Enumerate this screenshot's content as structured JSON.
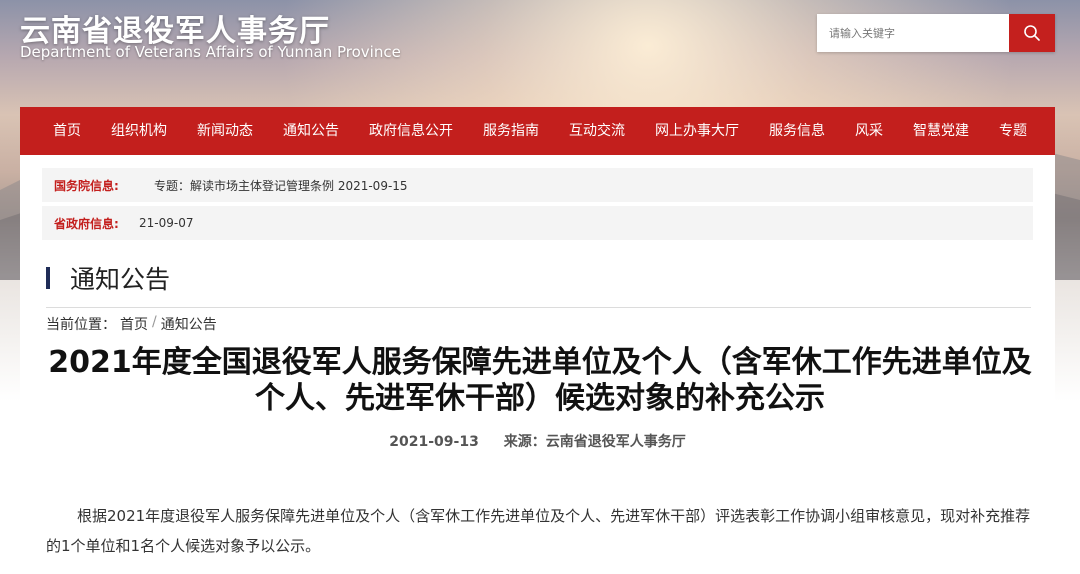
{
  "header": {
    "title": "云南省退役军人事务厅",
    "subtitle": "Department of Veterans Affairs of Yunnan Province"
  },
  "search": {
    "placeholder": "请输入关键字",
    "icon": "search-icon"
  },
  "nav": {
    "items": [
      "首页",
      "组织机构",
      "新闻动态",
      "通知公告",
      "政府信息公开",
      "服务指南",
      "互动交流",
      "网上办事大厅",
      "服务信息",
      "风采",
      "智慧党建",
      "专题"
    ]
  },
  "notices": [
    {
      "label": "国务院信息:",
      "text": "专题：解读市场主体登记管理条例 2021-09-15"
    },
    {
      "label": "省政府信息:",
      "text": "21-09-07"
    }
  ],
  "section": {
    "title": "通知公告"
  },
  "breadcrumb": {
    "prefix": "当前位置：",
    "home": "首页",
    "separator": "/",
    "current": "通知公告"
  },
  "article": {
    "title": "2021年度全国退役军人服务保障先进单位及个人（含军休工作先进单位及个人、先进军休干部）候选对象的补充公示",
    "date": "2021-09-13",
    "source": "来源：云南省退役军人事务厅",
    "body": "根据2021年度退役军人服务保障先进单位及个人（含军休工作先进单位及个人、先进军休干部）评选表彰工作协调小组审核意见，现对补充推荐的1个单位和1名个人候选对象予以公示。"
  },
  "colors": {
    "brand_red": "#c31f1d",
    "section_bar": "#1f2c57"
  }
}
